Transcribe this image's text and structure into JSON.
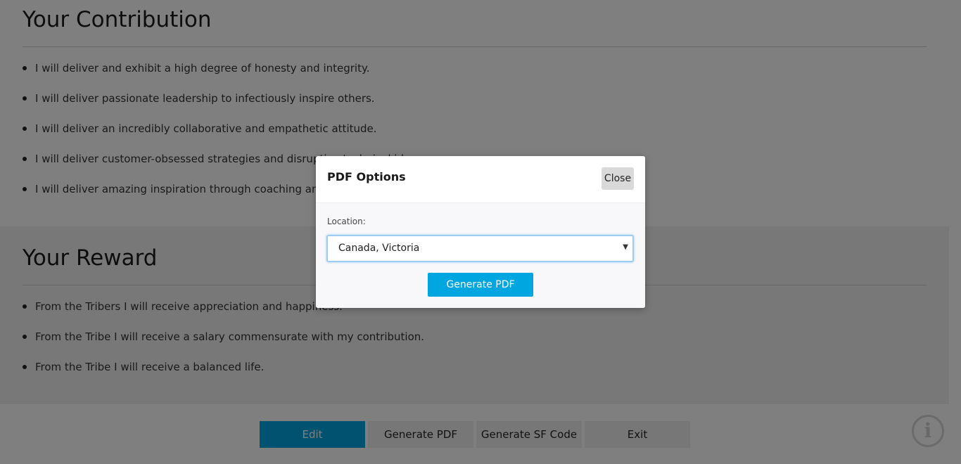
{
  "contribution": {
    "title": "Your Contribution",
    "items": [
      "I will deliver and exhibit a high degree of honesty and integrity.",
      "I will deliver passionate leadership to infectiously inspire others.",
      "I will deliver an incredibly collaborative and empathetic attitude.",
      "I will deliver customer-obsessed strategies and disruptive technical ideas.",
      "I will deliver amazing inspiration through coaching and mentoring."
    ]
  },
  "reward": {
    "title": "Your Reward",
    "items": [
      "From the Tribers I will receive appreciation and happiness.",
      "From the Tribe I will receive a salary commensurate with my contribution.",
      "From the Tribe I will receive a balanced life."
    ]
  },
  "footer": {
    "edit_label": "Edit",
    "generate_pdf_label": "Generate PDF",
    "generate_sf_label": "Generate SF Code",
    "exit_label": "Exit",
    "info_glyph": "i"
  },
  "modal": {
    "title": "PDF Options",
    "close_label": "Close",
    "location_label": "Location:",
    "location_value": "Canada, Victoria",
    "arrow_glyph": "▼",
    "generate_label": "Generate PDF"
  },
  "colors": {
    "accent": "#00a6e0",
    "overlay": "rgba(0,0,0,0.5)"
  }
}
